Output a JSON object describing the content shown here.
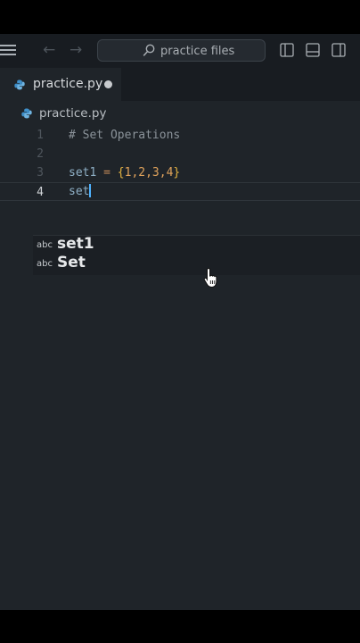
{
  "search": {
    "label": "practice files"
  },
  "tab": {
    "label": "practice.py"
  },
  "breadcrumb": {
    "file": "practice.py"
  },
  "editor": {
    "lines": [
      {
        "number": "1",
        "text": "# Set Operations"
      },
      {
        "number": "2",
        "text": ""
      },
      {
        "number": "3",
        "var": "set1",
        "op": " = ",
        "open": "{",
        "values": "1,2,3,4",
        "close": "}"
      },
      {
        "number": "4",
        "text": "set"
      }
    ]
  },
  "suggest": {
    "items": [
      {
        "kind": "abc",
        "label": "set1"
      },
      {
        "kind": "abc",
        "label": "Set"
      }
    ]
  },
  "colors": {
    "background": "#1f2429",
    "caret": "#4fb3ff",
    "number": "#e0a35c"
  }
}
